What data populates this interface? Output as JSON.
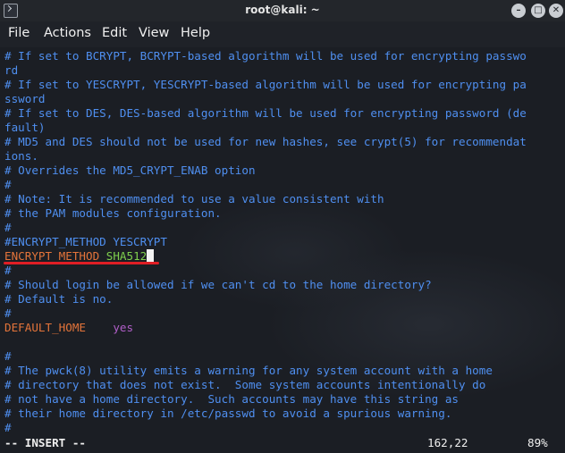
{
  "window": {
    "title": "root@kali: ~",
    "icon": "terminal-icon",
    "buttons": [
      {
        "name": "minimize",
        "glyph": "–"
      },
      {
        "name": "maximize",
        "glyph": "□"
      },
      {
        "name": "close",
        "glyph": "✕"
      }
    ]
  },
  "menu": [
    "File",
    "Actions",
    "Edit",
    "View",
    "Help"
  ],
  "editor": {
    "lines": [
      "# If set to BCRYPT, BCRYPT-based algorithm will be used for encrypting passwo",
      "rd",
      "# If set to YESCRYPT, YESCRYPT-based algorithm will be used for encrypting pa",
      "ssword",
      "# If set to DES, DES-based algorithm will be used for encrypting password (de",
      "fault)",
      "# MD5 and DES should not be used for new hashes, see crypt(5) for recommendat",
      "ions.",
      "# Overrides the MD5_CRYPT_ENAB option",
      "#",
      "# Note: It is recommended to use a value consistent with",
      "# the PAM modules configuration.",
      "#",
      "#ENCRYPT_METHOD YESCRYPT"
    ],
    "active_line": {
      "key": "ENCRYPT_METHOD",
      "value": "SHA512"
    },
    "lines_after": [
      "#",
      "# Should login be allowed if we can't cd to the home directory?",
      "# Default is no.",
      "#"
    ],
    "default_home": {
      "key": "DEFAULT_HOME",
      "value": "yes"
    },
    "lines_end": [
      "",
      "#",
      "# The pwck(8) utility emits a warning for any system account with a home",
      "# directory that does not exist.  Some system accounts intentionally do",
      "# not have a home directory.  Such accounts may have this string as",
      "# their home directory in /etc/passwd to avoid a spurious warning.",
      "#"
    ]
  },
  "status": {
    "mode": "-- INSERT --",
    "position": "162,22",
    "percent": "89%"
  },
  "colors": {
    "comment": "#4f8ff0",
    "keyword": "#e4743a",
    "value": "#7fd04d",
    "value_alt": "#b05ec8",
    "annotation_underline": "#e01e25"
  }
}
